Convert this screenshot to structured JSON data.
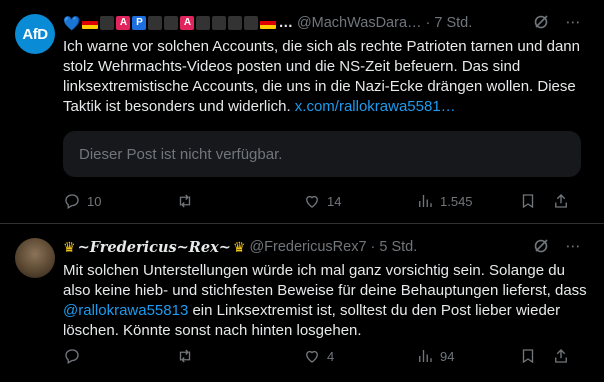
{
  "tweet1": {
    "display_name_prefix": "💙",
    "display_name_suffix": "…",
    "handle": "@MachWasDara…",
    "dot": "·",
    "time": "7 Std.",
    "avatar_text": "AfD",
    "text": "Ich warne vor solchen Accounts, die sich als rechte Patrioten tarnen und dann stolz Wehrmachts-Videos posten und die NS-Zeit befeuern. Das sind linksextremistische Accounts, die uns in die Nazi-Ecke drängen wollen. Diese Taktik ist besonders und widerlich. ",
    "link": "x.com/rallokrawa5581…",
    "quote_text": "Dieser Post ist nicht verfügbar.",
    "replies": "10",
    "reposts": "",
    "likes": "14",
    "views": "1.545"
  },
  "tweet2": {
    "display_name": "~Fredericus~Rex~",
    "handle": "@FredericusRex7",
    "dot": "·",
    "time": "5 Std.",
    "text_before": "Mit solchen Unterstellungen würde ich mal ganz vorsichtig sein. Solange du also keine hieb- und stichfesten Beweise für deine Behauptungen lieferst, dass ",
    "mention": "@rallokrawa55813",
    "text_after": " ein Linksextremist ist, solltest du den Post lieber wieder löschen. Könnte sonst nach hinten losgehen.",
    "replies": "",
    "reposts": "",
    "likes": "4",
    "views": "94"
  },
  "colors": {
    "background": "#000000",
    "text": "#e7e9ea",
    "muted": "#71767b",
    "link": "#1d9bf0",
    "divider": "#2f3336"
  }
}
